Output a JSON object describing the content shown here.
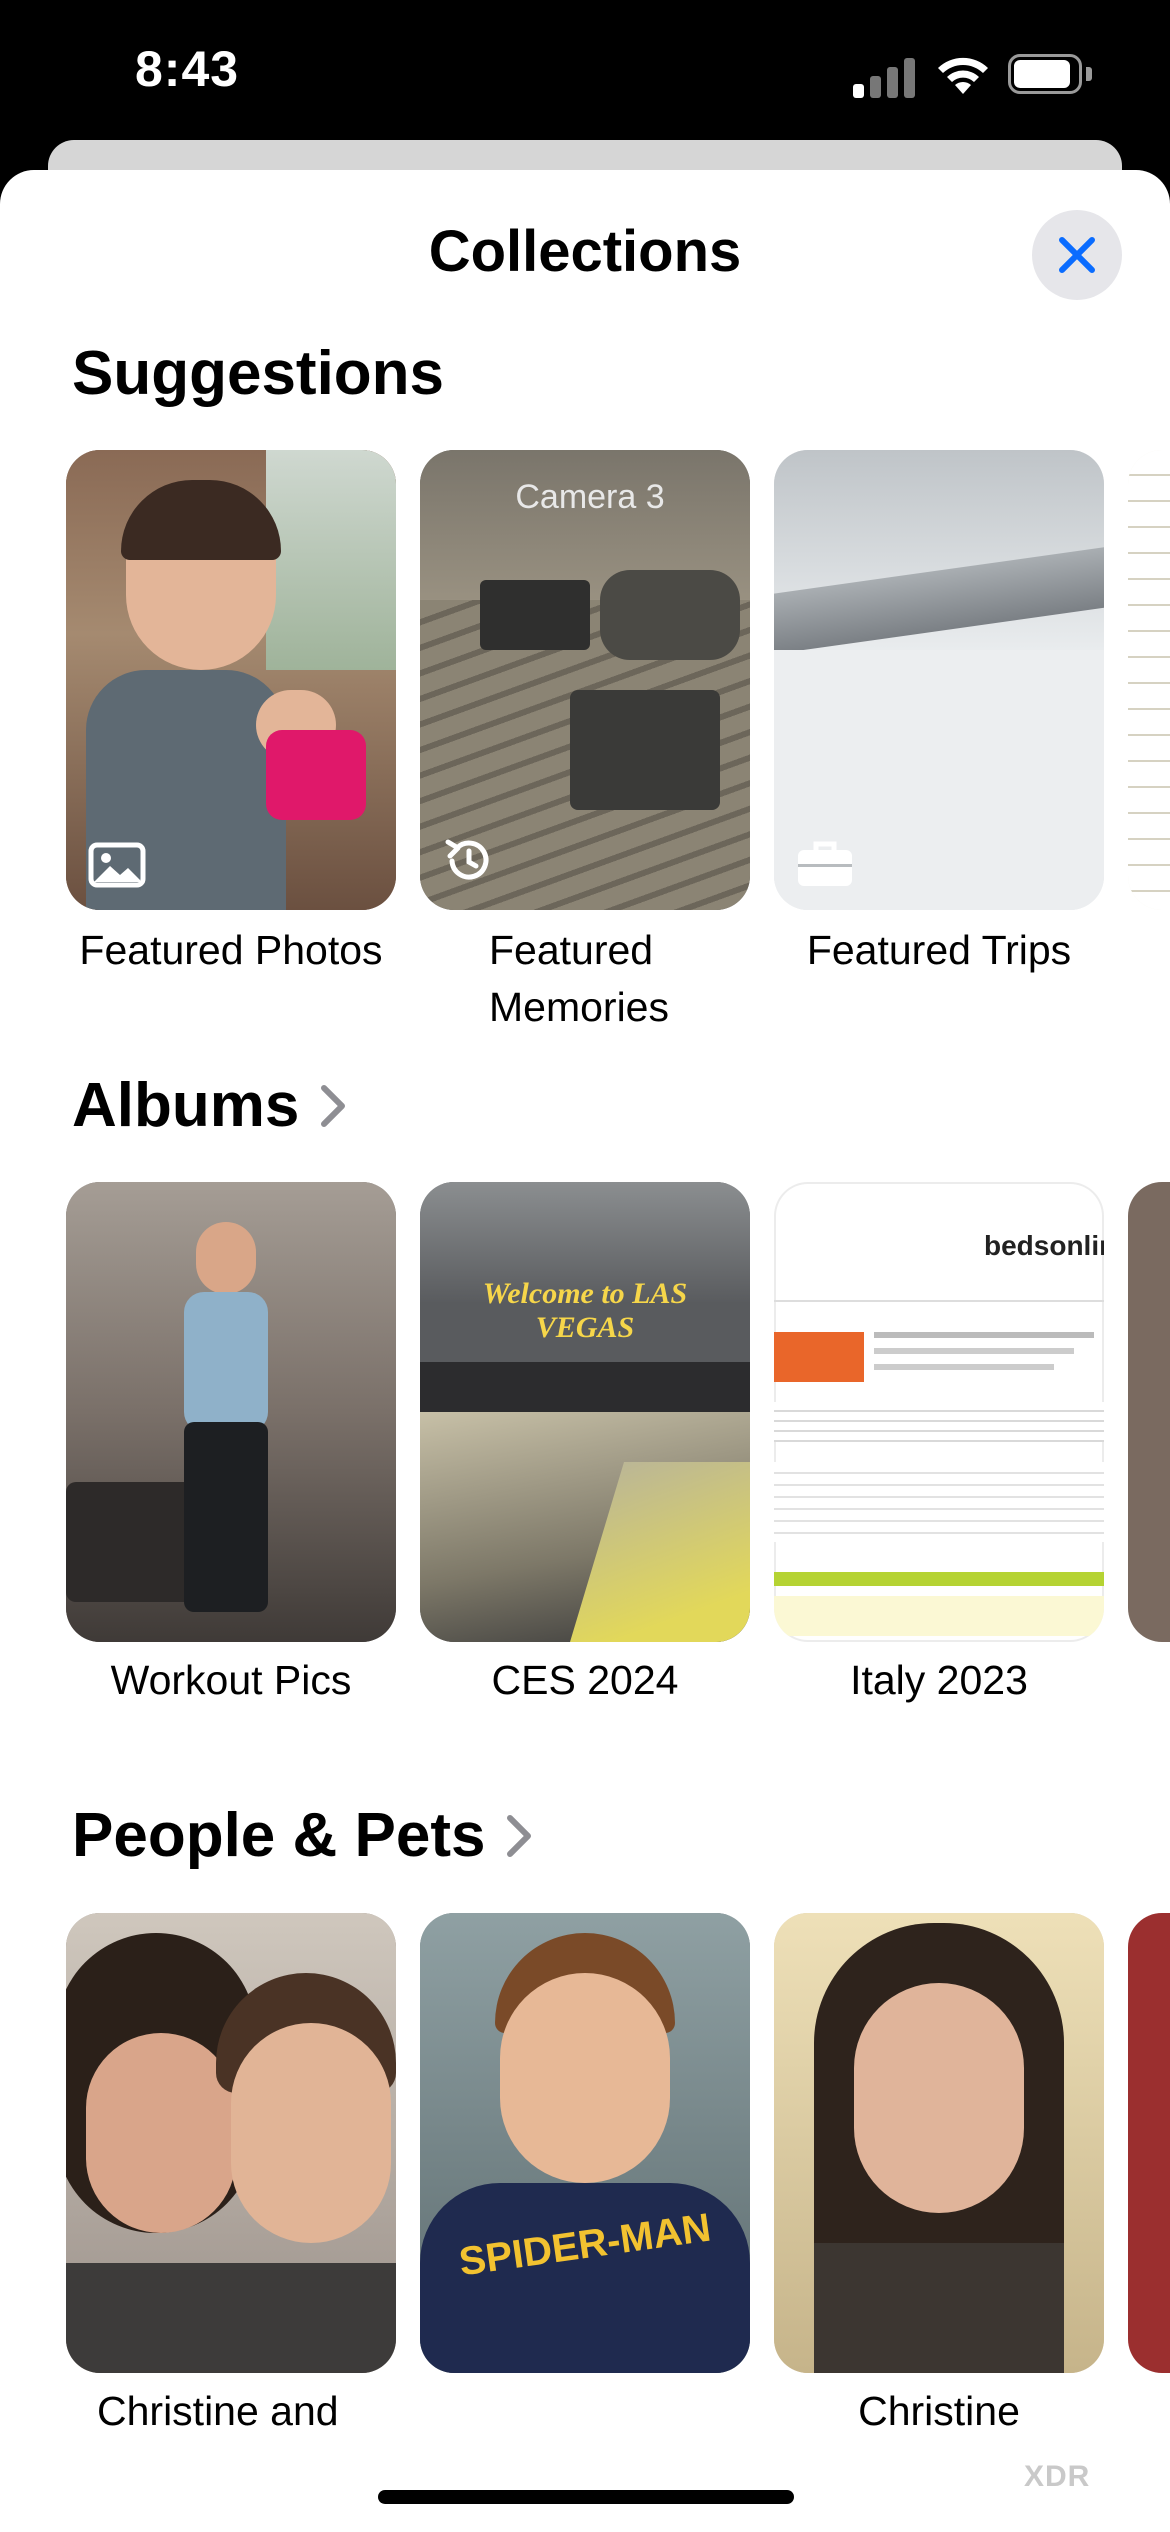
{
  "status_bar": {
    "time": "8:43"
  },
  "sheet": {
    "title": "Collections"
  },
  "sections": {
    "suggestions": {
      "title": "Suggestions",
      "items": [
        {
          "label": "Featured Photos",
          "icon": "photo-icon"
        },
        {
          "label": "Featured\nMemories",
          "icon": "memories-icon",
          "overlay": "Camera 3"
        },
        {
          "label": "Featured Trips",
          "icon": "briefcase-icon"
        }
      ]
    },
    "albums": {
      "title": "Albums",
      "items": [
        {
          "label": "Workout Pics"
        },
        {
          "label": "CES 2024",
          "overlay": "Welcome to LAS VEGAS"
        },
        {
          "label": "Italy 2023",
          "overlay": "bedsonline"
        }
      ]
    },
    "people": {
      "title": "People & Pets",
      "items": [
        {
          "label": "Christine and"
        },
        {
          "label": "",
          "overlay": "SPIDER-MAN"
        },
        {
          "label": "Christine"
        }
      ]
    }
  },
  "watermark": "XDR",
  "colors": {
    "accent": "#0a6cff",
    "sheet_bg": "#ffffff",
    "status_bg": "#000000"
  }
}
